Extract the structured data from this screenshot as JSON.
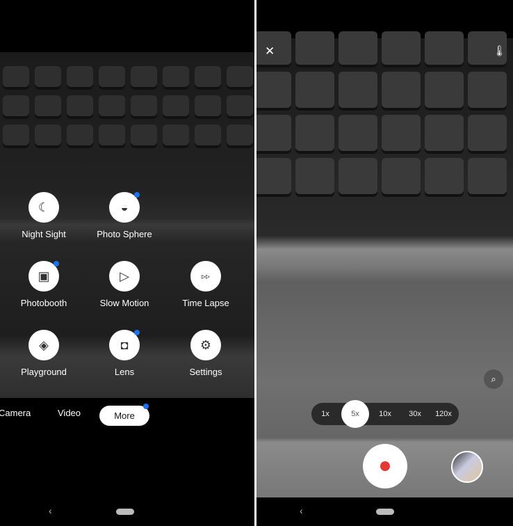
{
  "left": {
    "modes": [
      {
        "label": "Night Sight",
        "icon": "☾",
        "badge": false
      },
      {
        "label": "Photo Sphere",
        "icon": "◒",
        "badge": true
      },
      {
        "label": "Photobooth",
        "icon": "▣",
        "badge": true
      },
      {
        "label": "Slow Motion",
        "icon": "▷",
        "badge": false
      },
      {
        "label": "Time Lapse",
        "icon": "▹▹",
        "badge": false
      },
      {
        "label": "Playground",
        "icon": "◈",
        "badge": false
      },
      {
        "label": "Lens",
        "icon": "◘",
        "badge": true
      },
      {
        "label": "Settings",
        "icon": "⚙",
        "badge": false
      }
    ],
    "tabs": {
      "camera": "Camera",
      "video": "Video",
      "more": "More"
    },
    "nav": {
      "back": "‹"
    }
  },
  "right": {
    "close": "✕",
    "temp_icon": "🌡",
    "zoom_levels": [
      "1x",
      "5x",
      "10x",
      "30x",
      "120x"
    ],
    "selected_zoom": "5x",
    "record_color": "#e53935",
    "badge_color": "#1a73e8",
    "nav": {
      "back": "‹"
    }
  }
}
